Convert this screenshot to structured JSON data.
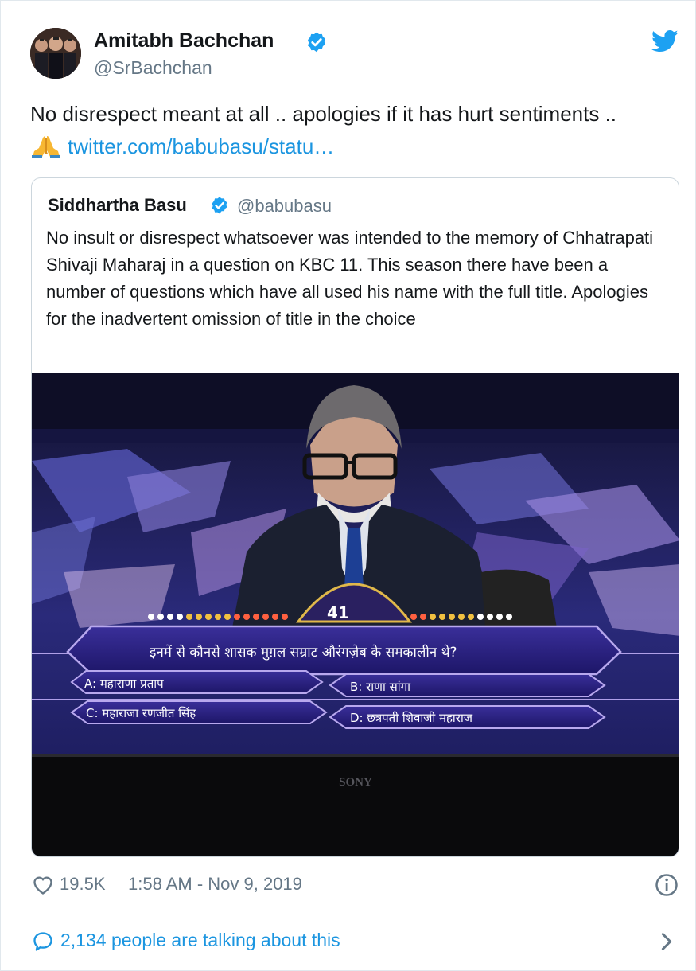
{
  "tweet": {
    "author_name": "Amitabh Bachchan",
    "author_handle": "@SrBachchan",
    "text": "No disrespect meant at all .. apologies if it has hurt sentiments  ..",
    "link": "twitter.com/babubasu/statu…",
    "likes": "19.5K",
    "timestamp": "1:58 AM - Nov 9, 2019",
    "talking": "2,134 people are talking about this"
  },
  "quoted": {
    "author_name": "Siddhartha Basu",
    "author_handle": "@babubasu",
    "text": "No insult or disrespect whatsoever was intended to the memory of Chhatrapati Shivaji Maharaj in a question on KBC 11. This season there have been a number of questions which have all used his name with the full title. Apologies for the inadvertent omission of title in the choice",
    "media": {
      "question_number": "41",
      "question": "इनमें से कौनसे शासक मुग़ल सम्राट औरंगज़ेब के समकालीन थे?",
      "option_a": "A: महाराणा प्रताप",
      "option_b": "B: राणा सांगा",
      "option_c": "C: महाराजा रणजीत सिंह",
      "option_d": "D: छत्रपती शिवाजी महाराज",
      "tv_brand": "SONY"
    }
  },
  "icons": [
    "verified-badge-icon",
    "twitter-bird-icon",
    "folded-hands-icon",
    "heart-icon",
    "info-icon",
    "speech-bubble-icon",
    "chevron-right-icon"
  ],
  "colors": {
    "link": "#1b95e0",
    "verified": "#1da1f2",
    "muted": "#657786"
  }
}
